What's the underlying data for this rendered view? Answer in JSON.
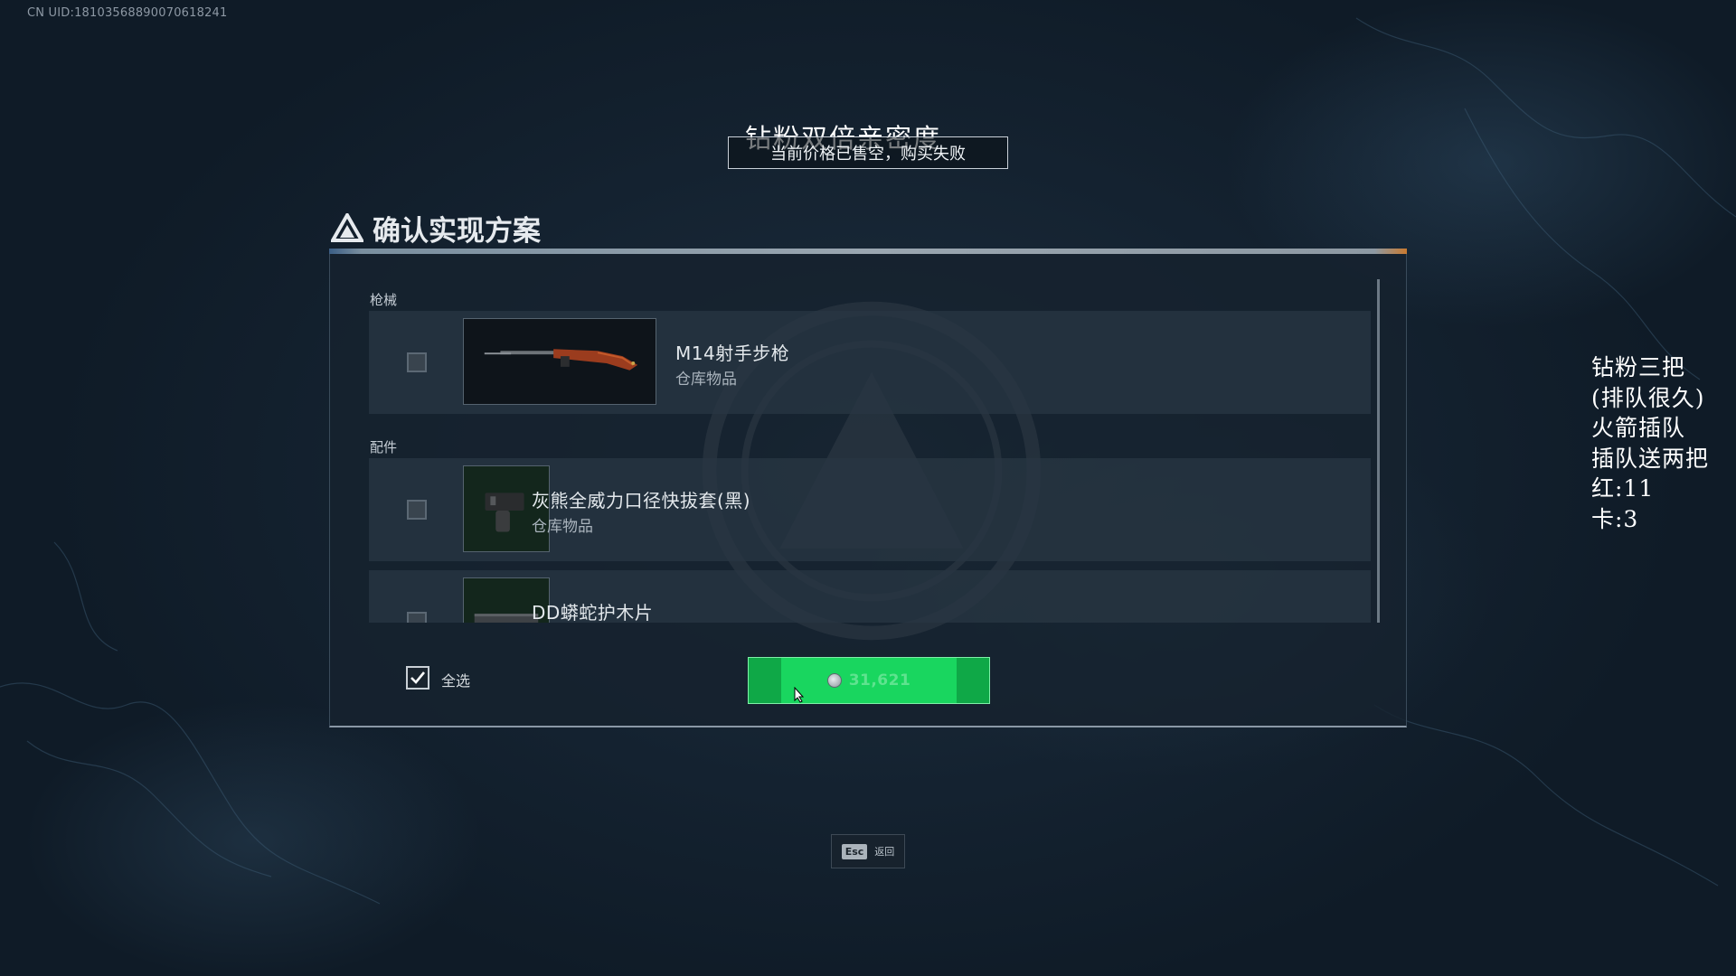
{
  "uid": "CN UID:18103568890070618241",
  "overlay": {
    "caption": "钻粉双倍亲密度",
    "toast": "当前价格已售空，购买失败",
    "notes": [
      "钻粉三把",
      "(排队很久)",
      "火箭插队",
      "插队送两把",
      "红:11",
      "卡:3"
    ]
  },
  "panel": {
    "title": "确认实现方案",
    "sections": [
      {
        "label": "枪械",
        "items": [
          {
            "name": "M14射手步枪",
            "subtitle": "仓库物品",
            "checked": false,
            "icon": "rifle-icon"
          }
        ]
      },
      {
        "label": "配件",
        "items": [
          {
            "name": "灰熊全威力口径快拔套(黑)",
            "subtitle": "仓库物品",
            "checked": false,
            "icon": "muzzle-device-icon"
          },
          {
            "name": "DD蟒蛇护木片",
            "subtitle": "",
            "checked": false,
            "icon": "handguard-panel-icon"
          }
        ]
      }
    ],
    "select_all_label": "全选",
    "select_all_checked": true,
    "price": "31,621",
    "currency_icon": "coin-icon"
  },
  "esc": {
    "key": "Esc",
    "label": "返回"
  },
  "colors": {
    "accent_green": "#19d65f",
    "price_text": "#5fe38f",
    "panel_bg": "#16222e"
  }
}
